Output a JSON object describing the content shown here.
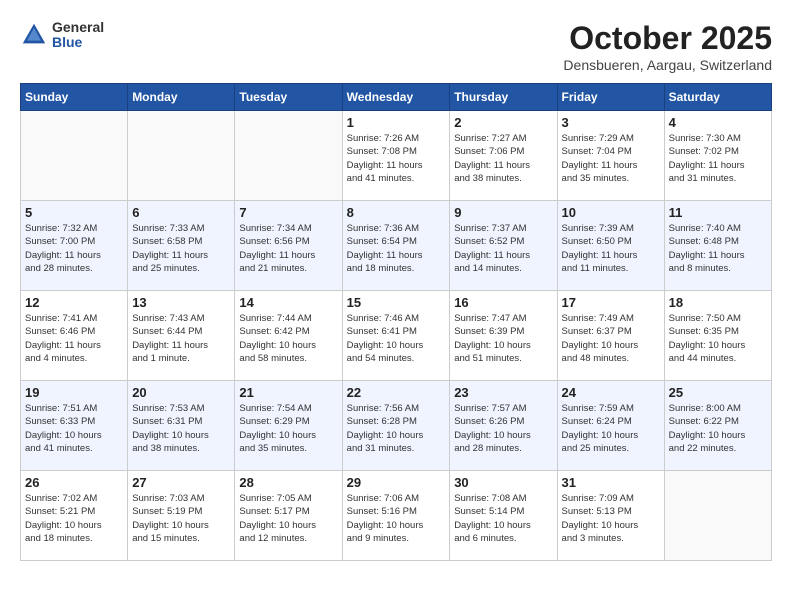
{
  "header": {
    "logo_general": "General",
    "logo_blue": "Blue",
    "month_title": "October 2025",
    "location": "Densbueren, Aargau, Switzerland"
  },
  "days_of_week": [
    "Sunday",
    "Monday",
    "Tuesday",
    "Wednesday",
    "Thursday",
    "Friday",
    "Saturday"
  ],
  "weeks": [
    [
      {
        "day": "",
        "info": ""
      },
      {
        "day": "",
        "info": ""
      },
      {
        "day": "",
        "info": ""
      },
      {
        "day": "1",
        "info": "Sunrise: 7:26 AM\nSunset: 7:08 PM\nDaylight: 11 hours\nand 41 minutes."
      },
      {
        "day": "2",
        "info": "Sunrise: 7:27 AM\nSunset: 7:06 PM\nDaylight: 11 hours\nand 38 minutes."
      },
      {
        "day": "3",
        "info": "Sunrise: 7:29 AM\nSunset: 7:04 PM\nDaylight: 11 hours\nand 35 minutes."
      },
      {
        "day": "4",
        "info": "Sunrise: 7:30 AM\nSunset: 7:02 PM\nDaylight: 11 hours\nand 31 minutes."
      }
    ],
    [
      {
        "day": "5",
        "info": "Sunrise: 7:32 AM\nSunset: 7:00 PM\nDaylight: 11 hours\nand 28 minutes."
      },
      {
        "day": "6",
        "info": "Sunrise: 7:33 AM\nSunset: 6:58 PM\nDaylight: 11 hours\nand 25 minutes."
      },
      {
        "day": "7",
        "info": "Sunrise: 7:34 AM\nSunset: 6:56 PM\nDaylight: 11 hours\nand 21 minutes."
      },
      {
        "day": "8",
        "info": "Sunrise: 7:36 AM\nSunset: 6:54 PM\nDaylight: 11 hours\nand 18 minutes."
      },
      {
        "day": "9",
        "info": "Sunrise: 7:37 AM\nSunset: 6:52 PM\nDaylight: 11 hours\nand 14 minutes."
      },
      {
        "day": "10",
        "info": "Sunrise: 7:39 AM\nSunset: 6:50 PM\nDaylight: 11 hours\nand 11 minutes."
      },
      {
        "day": "11",
        "info": "Sunrise: 7:40 AM\nSunset: 6:48 PM\nDaylight: 11 hours\nand 8 minutes."
      }
    ],
    [
      {
        "day": "12",
        "info": "Sunrise: 7:41 AM\nSunset: 6:46 PM\nDaylight: 11 hours\nand 4 minutes."
      },
      {
        "day": "13",
        "info": "Sunrise: 7:43 AM\nSunset: 6:44 PM\nDaylight: 11 hours\nand 1 minute."
      },
      {
        "day": "14",
        "info": "Sunrise: 7:44 AM\nSunset: 6:42 PM\nDaylight: 10 hours\nand 58 minutes."
      },
      {
        "day": "15",
        "info": "Sunrise: 7:46 AM\nSunset: 6:41 PM\nDaylight: 10 hours\nand 54 minutes."
      },
      {
        "day": "16",
        "info": "Sunrise: 7:47 AM\nSunset: 6:39 PM\nDaylight: 10 hours\nand 51 minutes."
      },
      {
        "day": "17",
        "info": "Sunrise: 7:49 AM\nSunset: 6:37 PM\nDaylight: 10 hours\nand 48 minutes."
      },
      {
        "day": "18",
        "info": "Sunrise: 7:50 AM\nSunset: 6:35 PM\nDaylight: 10 hours\nand 44 minutes."
      }
    ],
    [
      {
        "day": "19",
        "info": "Sunrise: 7:51 AM\nSunset: 6:33 PM\nDaylight: 10 hours\nand 41 minutes."
      },
      {
        "day": "20",
        "info": "Sunrise: 7:53 AM\nSunset: 6:31 PM\nDaylight: 10 hours\nand 38 minutes."
      },
      {
        "day": "21",
        "info": "Sunrise: 7:54 AM\nSunset: 6:29 PM\nDaylight: 10 hours\nand 35 minutes."
      },
      {
        "day": "22",
        "info": "Sunrise: 7:56 AM\nSunset: 6:28 PM\nDaylight: 10 hours\nand 31 minutes."
      },
      {
        "day": "23",
        "info": "Sunrise: 7:57 AM\nSunset: 6:26 PM\nDaylight: 10 hours\nand 28 minutes."
      },
      {
        "day": "24",
        "info": "Sunrise: 7:59 AM\nSunset: 6:24 PM\nDaylight: 10 hours\nand 25 minutes."
      },
      {
        "day": "25",
        "info": "Sunrise: 8:00 AM\nSunset: 6:22 PM\nDaylight: 10 hours\nand 22 minutes."
      }
    ],
    [
      {
        "day": "26",
        "info": "Sunrise: 7:02 AM\nSunset: 5:21 PM\nDaylight: 10 hours\nand 18 minutes."
      },
      {
        "day": "27",
        "info": "Sunrise: 7:03 AM\nSunset: 5:19 PM\nDaylight: 10 hours\nand 15 minutes."
      },
      {
        "day": "28",
        "info": "Sunrise: 7:05 AM\nSunset: 5:17 PM\nDaylight: 10 hours\nand 12 minutes."
      },
      {
        "day": "29",
        "info": "Sunrise: 7:06 AM\nSunset: 5:16 PM\nDaylight: 10 hours\nand 9 minutes."
      },
      {
        "day": "30",
        "info": "Sunrise: 7:08 AM\nSunset: 5:14 PM\nDaylight: 10 hours\nand 6 minutes."
      },
      {
        "day": "31",
        "info": "Sunrise: 7:09 AM\nSunset: 5:13 PM\nDaylight: 10 hours\nand 3 minutes."
      },
      {
        "day": "",
        "info": ""
      }
    ]
  ]
}
